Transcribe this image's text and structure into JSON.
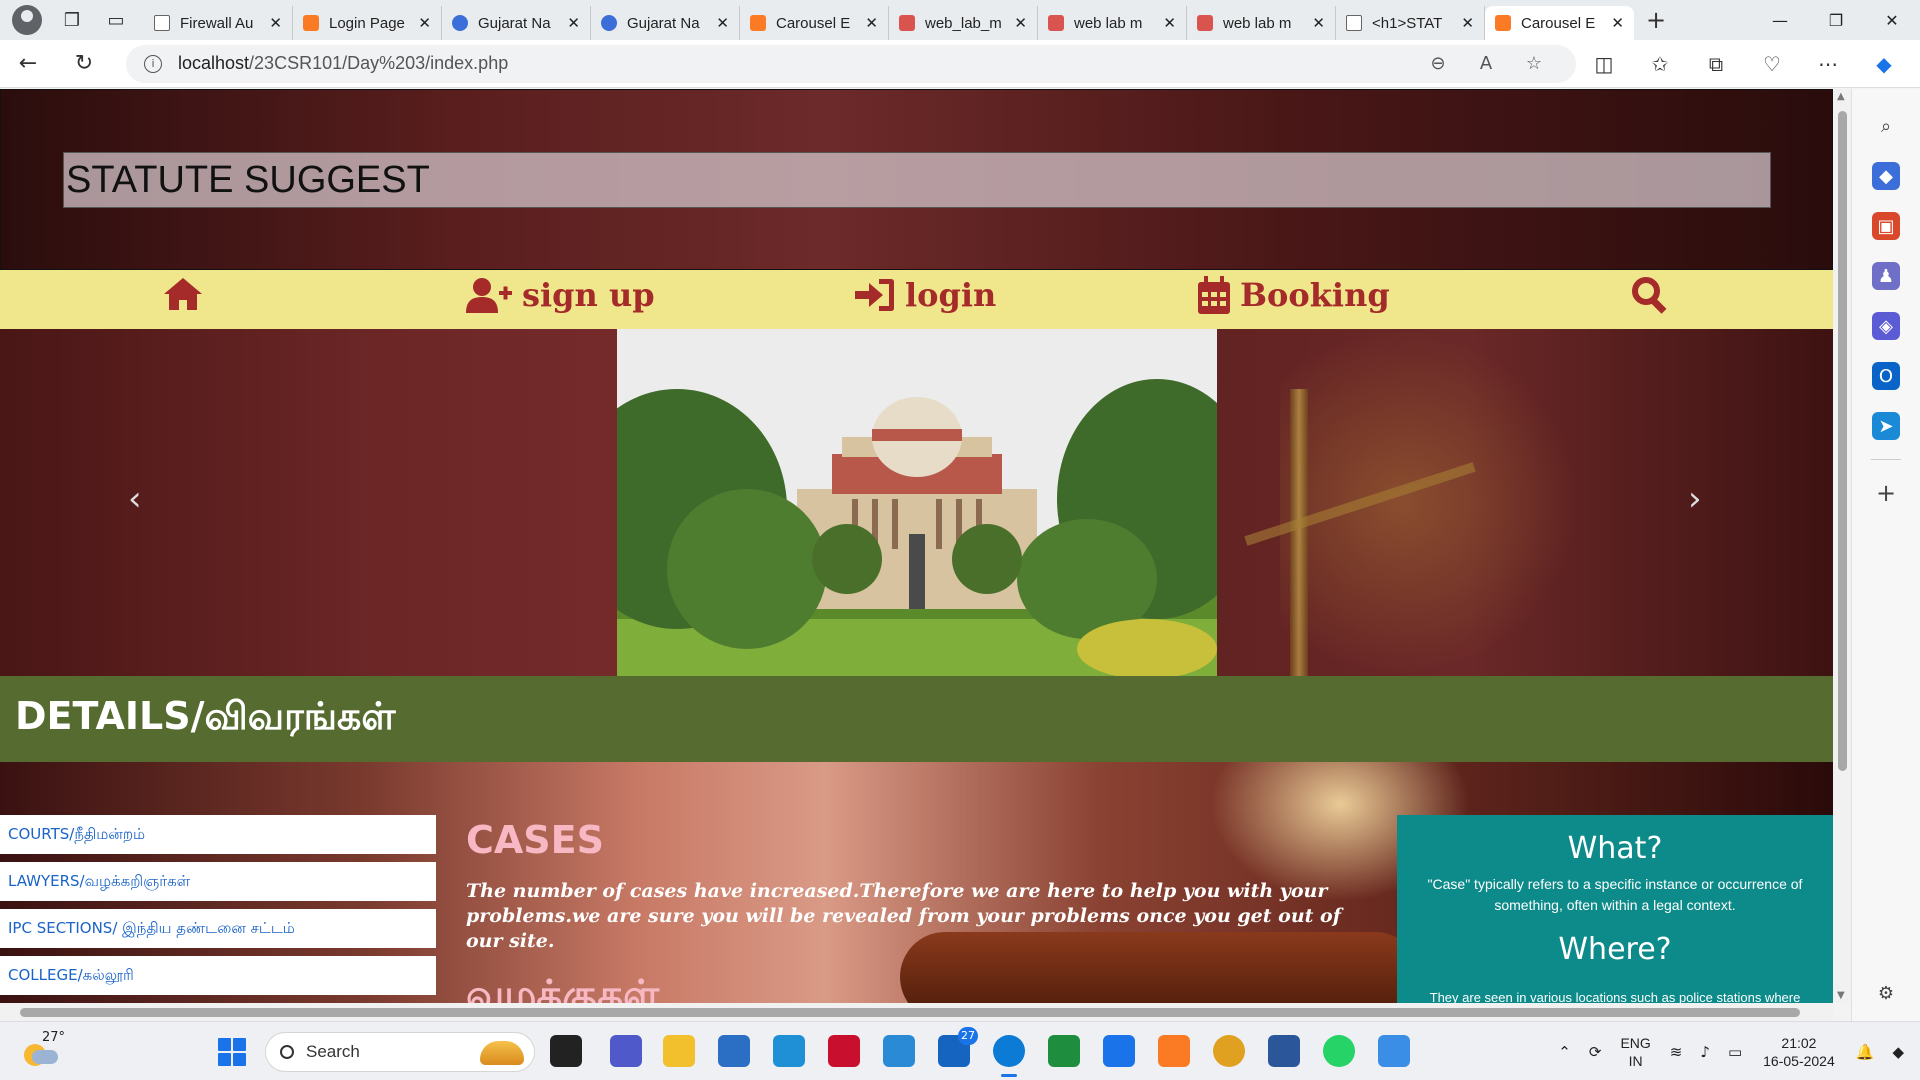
{
  "browser": {
    "tabs": [
      {
        "title": "Firewall Au",
        "favicon": "doc"
      },
      {
        "title": "Login Page",
        "favicon": "xampp"
      },
      {
        "title": "Gujarat Na",
        "favicon": "edge"
      },
      {
        "title": "Gujarat Na",
        "favicon": "edge"
      },
      {
        "title": "Carousel E",
        "favicon": "xampp"
      },
      {
        "title": "web_lab_m",
        "favicon": "pdf"
      },
      {
        "title": "web lab m",
        "favicon": "pdf"
      },
      {
        "title": "web lab m",
        "favicon": "pdf"
      },
      {
        "title": "<h1>STAT",
        "favicon": "doc"
      },
      {
        "title": "Carousel E",
        "favicon": "xampp",
        "active": true
      }
    ],
    "url_host": "localhost",
    "url_path": "/23CSR101/Day%203/index.php"
  },
  "page": {
    "header_title": "STATUTE SUGGEST",
    "nav": {
      "signup": "sign up",
      "login": "login",
      "booking": "Booking"
    },
    "details_heading": "DETAILS/விவரங்கள்",
    "side_links": [
      "COURTS/நீதிமன்றம்",
      "LAWYERS/வழக்கறிஞர்கள்",
      "IPC SECTIONS/ இந்திய தண்டனை சட்டம்",
      "COLLEGE/கல்லூரி"
    ],
    "cases_heading": "CASES",
    "cases_text": "The number of cases have increased.Therefore we are here to help you with your problems.we are sure you will be revealed from your problems once you get out of our site.",
    "cases_tamil": "வழக்குகள்",
    "info": {
      "what_heading": "What?",
      "what_text": "\"Case\" typically refers to a specific instance or occurrence of something, often within a legal context.",
      "where_heading": "Where?",
      "where_text": "They are seen in various locations such as police stations where"
    }
  },
  "taskbar": {
    "weather_temp": "27°",
    "search_placeholder": "Search",
    "mail_badge": "27",
    "lang_line1": "ENG",
    "lang_line2": "IN",
    "time": "21:02",
    "date": "16-05-2024"
  },
  "colors": {
    "nav_bg": "#f0e68c",
    "nav_fg": "#a52a2a",
    "details_bg": "#556b2f",
    "info_bg": "#0d8a8a",
    "cases_heading": "#f7b8c4",
    "link": "#1a63c8"
  }
}
